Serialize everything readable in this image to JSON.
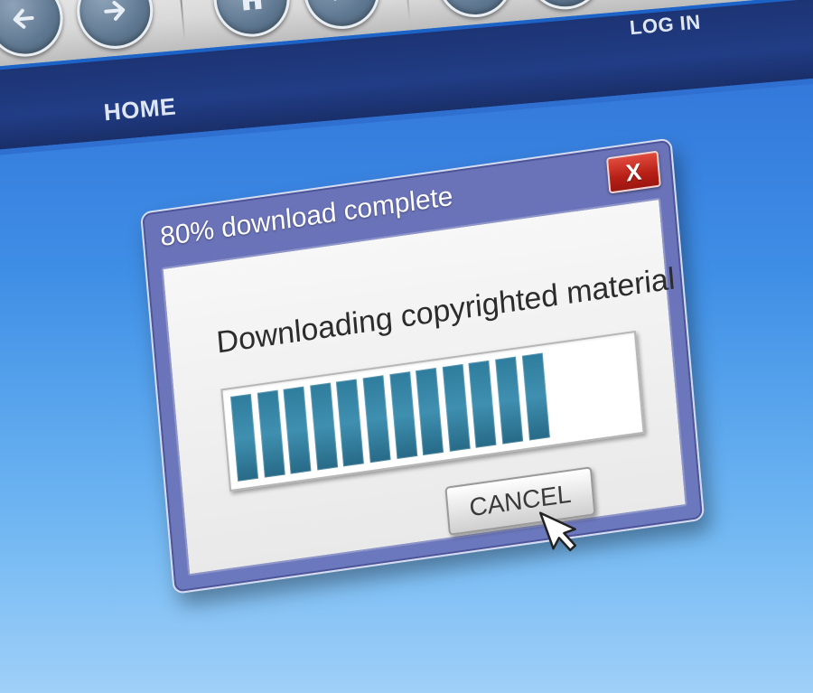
{
  "navbar": {
    "home_label": "HOME",
    "login_label": "LOG IN"
  },
  "toolbar": {
    "buttons": [
      {
        "icon": "back-arrow-icon"
      },
      {
        "icon": "forward-arrow-icon"
      },
      {
        "icon": "home-icon"
      },
      {
        "icon": "stop-icon"
      },
      {
        "icon": "refresh-icon"
      },
      {
        "icon": "close-icon"
      }
    ]
  },
  "dialog": {
    "title": "80% download complete",
    "close_label": "X",
    "message": "Downloading copyrighted material",
    "progress_fraction": 0.8,
    "progress_segments_total": 15,
    "cancel_label": "CANCEL"
  },
  "colors": {
    "background": "#3f8fe6",
    "navbar": "#213d85",
    "dialog_frame": "#6a72b8",
    "close_button": "#b71f16",
    "progress_bar": "#2f7d9d"
  }
}
